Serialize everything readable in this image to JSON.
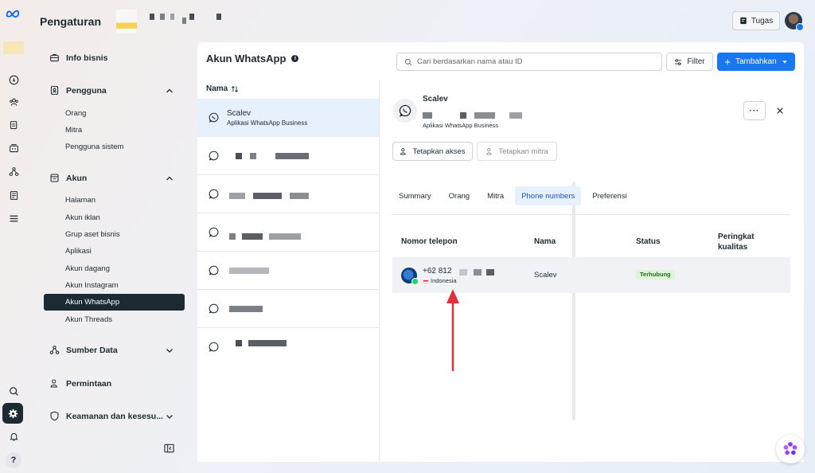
{
  "topbar": {
    "title": "Pengaturan",
    "tasks_label": "Tugas"
  },
  "sidenav": {
    "info_bisnis": "Info bisnis",
    "pengguna": {
      "label": "Pengguna",
      "items": [
        "Orang",
        "Mitra",
        "Pengguna sistem"
      ]
    },
    "akun": {
      "label": "Akun",
      "items": [
        "Halaman",
        "Akun iklan",
        "Grup aset bisnis",
        "Aplikasi",
        "Akun dagang",
        "Akun Instagram",
        "Akun WhatsApp",
        "Akun Threads"
      ],
      "active": "Akun WhatsApp"
    },
    "sumber_data": "Sumber Data",
    "permintaan": "Permintaan",
    "keamanan": "Keamanan dan kesesu..."
  },
  "panel": {
    "title": "Akun WhatsApp",
    "search_placeholder": "Cari berdasarkan nama atau ID",
    "filter_label": "Filter",
    "add_label": "Tambahkan",
    "list_header": "Nama",
    "selected_account": {
      "name": "Scalev",
      "subtitle": "Aplikasi WhatsApp Business"
    }
  },
  "detail": {
    "name": "Scalev",
    "subtitle": "Aplikasi WhatsApp Business",
    "assign_access": "Tetapkan akses",
    "assign_partner": "Tetapkan mitra",
    "tabs": [
      "Summary",
      "Orang",
      "Mitra",
      "Phone numbers",
      "Preferensi"
    ],
    "active_tab": "Phone numbers",
    "table": {
      "headers": [
        "Nomor telepon",
        "Nama",
        "Status",
        "Peringkat kualitas"
      ],
      "rows": [
        {
          "phone": "+62 812",
          "country": "Indonesia",
          "name": "Scalev",
          "status": "Terhubung",
          "quality": ""
        }
      ]
    }
  },
  "colors": {
    "accent": "#1877f2",
    "nav_active": "#1c2b33",
    "selected_row": "#e7f0fd",
    "status_ok": "#dff3d8",
    "arrow": "#e0313b"
  }
}
